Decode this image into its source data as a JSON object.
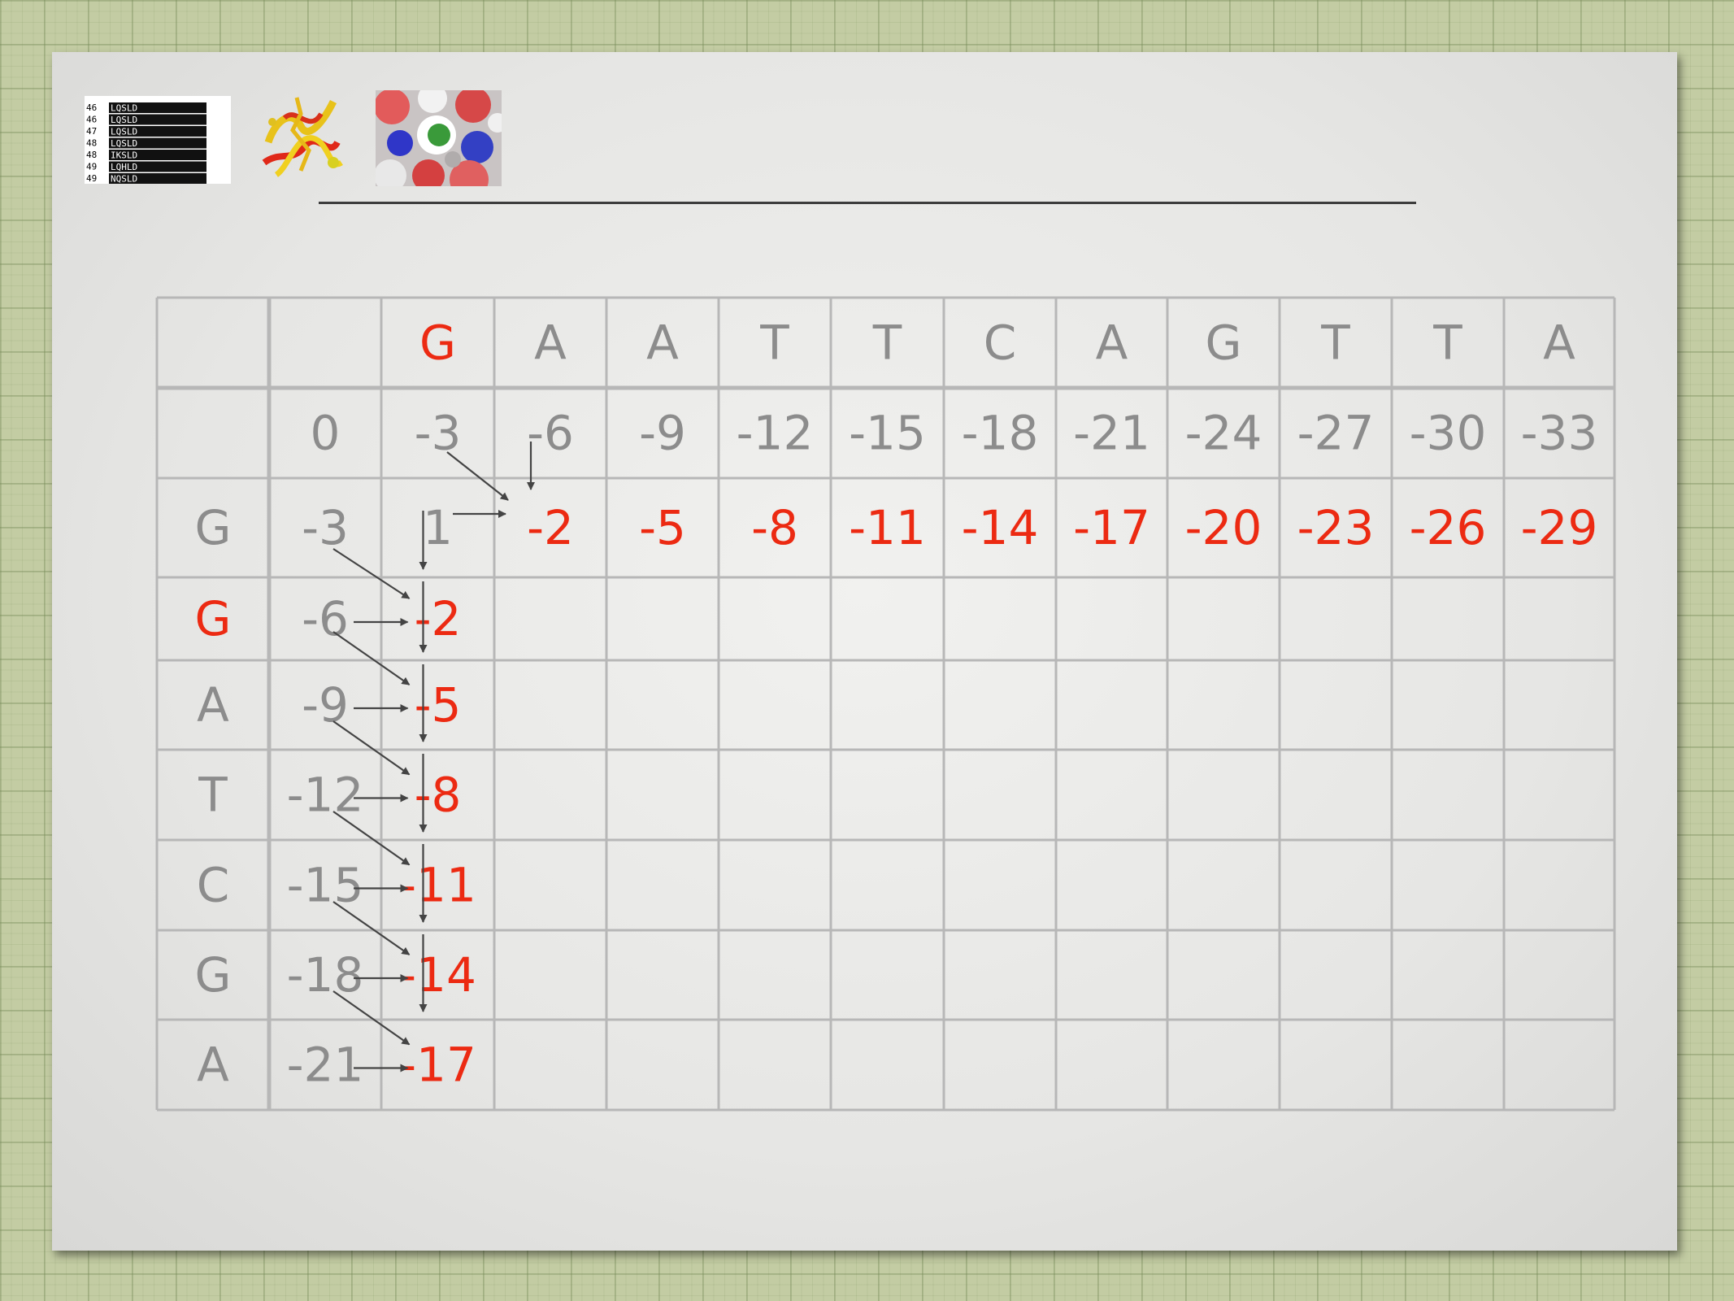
{
  "colors": {
    "background": "#c3cca3",
    "grid_line": "#b7b7b7",
    "label_gray": "#8c8c8c",
    "highlight_red": "#ec2a12",
    "arrow": "#444444"
  },
  "thumbnails": {
    "alignment_rows": [
      {
        "num": "46",
        "seq": "LQSLD"
      },
      {
        "num": "46",
        "seq": "LQSLD"
      },
      {
        "num": "47",
        "seq": "LQSLD"
      },
      {
        "num": "48",
        "seq": "LQSLD"
      },
      {
        "num": "48",
        "seq": "IKSLD"
      },
      {
        "num": "49",
        "seq": "LQHLD"
      },
      {
        "num": "49",
        "seq": "NQSLD"
      }
    ]
  },
  "matrix": {
    "header_seq": [
      "G",
      "A",
      "A",
      "T",
      "T",
      "C",
      "A",
      "G",
      "T",
      "T",
      "A"
    ],
    "header_highlight_index": 0,
    "init_row": [
      "0",
      "-3",
      "-6",
      "-9",
      "-12",
      "-15",
      "-18",
      "-21",
      "-24",
      "-27",
      "-30",
      "-33"
    ],
    "rows": [
      {
        "base": "G",
        "base_red": false,
        "values": [
          "-3",
          "1",
          "-2",
          "-5",
          "-8",
          "-11",
          "-14",
          "-17",
          "-20",
          "-23",
          "-26",
          "-29"
        ],
        "red_from": 2
      },
      {
        "base": "G",
        "base_red": true,
        "values": [
          "-6",
          "-2",
          "",
          "",
          "",
          "",
          "",
          "",
          "",
          "",
          "",
          ""
        ],
        "red_from": 1
      },
      {
        "base": "A",
        "base_red": false,
        "values": [
          "-9",
          "-5",
          "",
          "",
          "",
          "",
          "",
          "",
          "",
          "",
          "",
          ""
        ],
        "red_from": 1
      },
      {
        "base": "T",
        "base_red": false,
        "values": [
          "-12",
          "-8",
          "",
          "",
          "",
          "",
          "",
          "",
          "",
          "",
          "",
          ""
        ],
        "red_from": 1
      },
      {
        "base": "C",
        "base_red": false,
        "values": [
          "-15",
          "-11",
          "",
          "",
          "",
          "",
          "",
          "",
          "",
          "",
          "",
          ""
        ],
        "red_from": 1
      },
      {
        "base": "G",
        "base_red": false,
        "values": [
          "-18",
          "-14",
          "",
          "",
          "",
          "",
          "",
          "",
          "",
          "",
          "",
          ""
        ],
        "red_from": 1
      },
      {
        "base": "A",
        "base_red": false,
        "values": [
          "-21",
          "-17",
          "",
          "",
          "",
          "",
          "",
          "",
          "",
          "",
          "",
          ""
        ],
        "red_from": 1
      }
    ]
  }
}
